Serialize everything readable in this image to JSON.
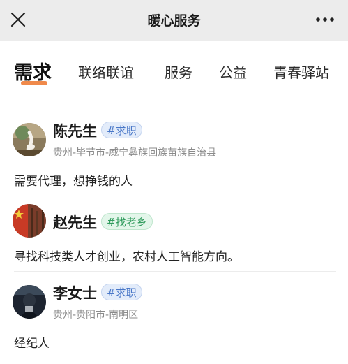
{
  "header": {
    "title": "暖心服务",
    "close_icon": "close-icon",
    "more_icon": "more-icon"
  },
  "tabs": [
    {
      "label": "需求",
      "active": true
    },
    {
      "label": "联络联谊",
      "active": false
    },
    {
      "label": "服务",
      "active": false
    },
    {
      "label": "公益",
      "active": false
    },
    {
      "label": "青春驿站",
      "active": false
    }
  ],
  "colors": {
    "accent": "#f08a4b",
    "tag_blue": "#4a78c8",
    "tag_green": "#2f9b5c"
  },
  "posts": [
    {
      "name": "陈先生",
      "tag": "#求职",
      "tag_color": "blue",
      "location": "贵州-毕节市-威宁彝族回族苗族自治县",
      "content": "需要代理，想挣钱的人"
    },
    {
      "name": "赵先生",
      "tag": "#找老乡",
      "tag_color": "green",
      "location": "",
      "content": "寻找科技类人才创业，农村人工智能方向。"
    },
    {
      "name": "李女士",
      "tag": "#求职",
      "tag_color": "blue",
      "location": "贵州-贵阳市-南明区",
      "content": "经纪人"
    }
  ]
}
